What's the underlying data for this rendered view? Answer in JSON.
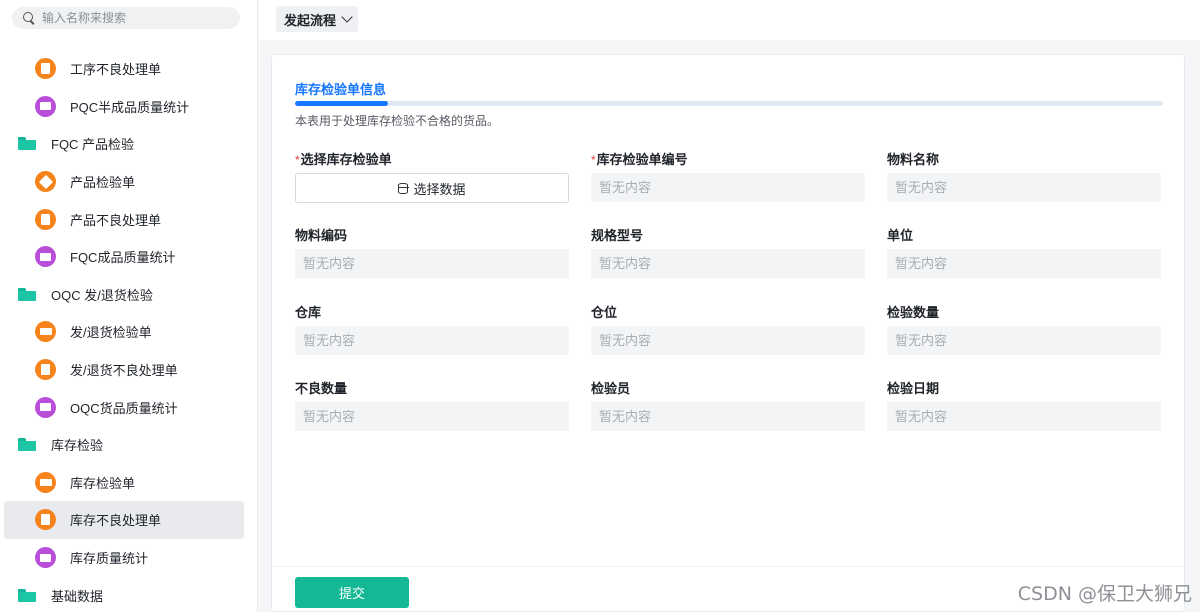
{
  "search": {
    "placeholder": "输入名称来搜索"
  },
  "sidebar": {
    "items": [
      {
        "label": "工序不良处理单",
        "kind": "child",
        "icon": "document-icon",
        "color": "#f7831c"
      },
      {
        "label": "PQC半成品质量统计",
        "kind": "child",
        "icon": "chart-icon",
        "color": "#b94fd9"
      },
      {
        "label": "FQC 产品检验",
        "kind": "group",
        "icon": "folder-icon",
        "color": "#1cc6a5"
      },
      {
        "label": "产品检验单",
        "kind": "child",
        "icon": "box-icon",
        "color": "#f7831c"
      },
      {
        "label": "产品不良处理单",
        "kind": "child",
        "icon": "document-icon",
        "color": "#f7831c"
      },
      {
        "label": "FQC成品质量统计",
        "kind": "child",
        "icon": "chart-icon",
        "color": "#b94fd9"
      },
      {
        "label": "OQC 发/退货检验",
        "kind": "group",
        "icon": "folder-icon",
        "color": "#1cc6a5"
      },
      {
        "label": "发/退货检验单",
        "kind": "child",
        "icon": "truck-icon",
        "color": "#f7831c"
      },
      {
        "label": "发/退货不良处理单",
        "kind": "child",
        "icon": "document-icon",
        "color": "#f7831c"
      },
      {
        "label": "OQC货品质量统计",
        "kind": "child",
        "icon": "chart-icon",
        "color": "#b94fd9"
      },
      {
        "label": "库存检验",
        "kind": "group",
        "icon": "folder-icon",
        "color": "#1cc6a5"
      },
      {
        "label": "库存检验单",
        "kind": "child",
        "icon": "truck-icon",
        "color": "#f7831c"
      },
      {
        "label": "库存不良处理单",
        "kind": "child",
        "icon": "document-icon",
        "color": "#f7831c",
        "active": true
      },
      {
        "label": "库存质量统计",
        "kind": "child",
        "icon": "chart-icon",
        "color": "#b94fd9"
      },
      {
        "label": "基础数据",
        "kind": "group",
        "icon": "folder-icon",
        "color": "#1cc6a5"
      }
    ]
  },
  "topbar": {
    "flow_label": "发起流程"
  },
  "form": {
    "section_title": "库存检验单信息",
    "section_progress": 0.107,
    "description": "本表用于处理库存检验不合格的货品。",
    "select_button_label": "选择数据",
    "empty_text": "暂无内容",
    "fields": {
      "select_inspection": "选择库存检验单",
      "inspection_no": "库存检验单编号",
      "material_name": "物料名称",
      "material_code": "物料编码",
      "spec_model": "规格型号",
      "unit": "单位",
      "warehouse": "仓库",
      "location": "仓位",
      "inspect_qty": "检验数量",
      "defect_qty": "不良数量",
      "inspector": "检验员",
      "inspect_date": "检验日期"
    },
    "submit_label": "提交"
  },
  "watermark": "CSDN @保卫大狮兄",
  "colors": {
    "accent": "#1677ff",
    "submit": "#14b894",
    "required": "#e53935"
  }
}
